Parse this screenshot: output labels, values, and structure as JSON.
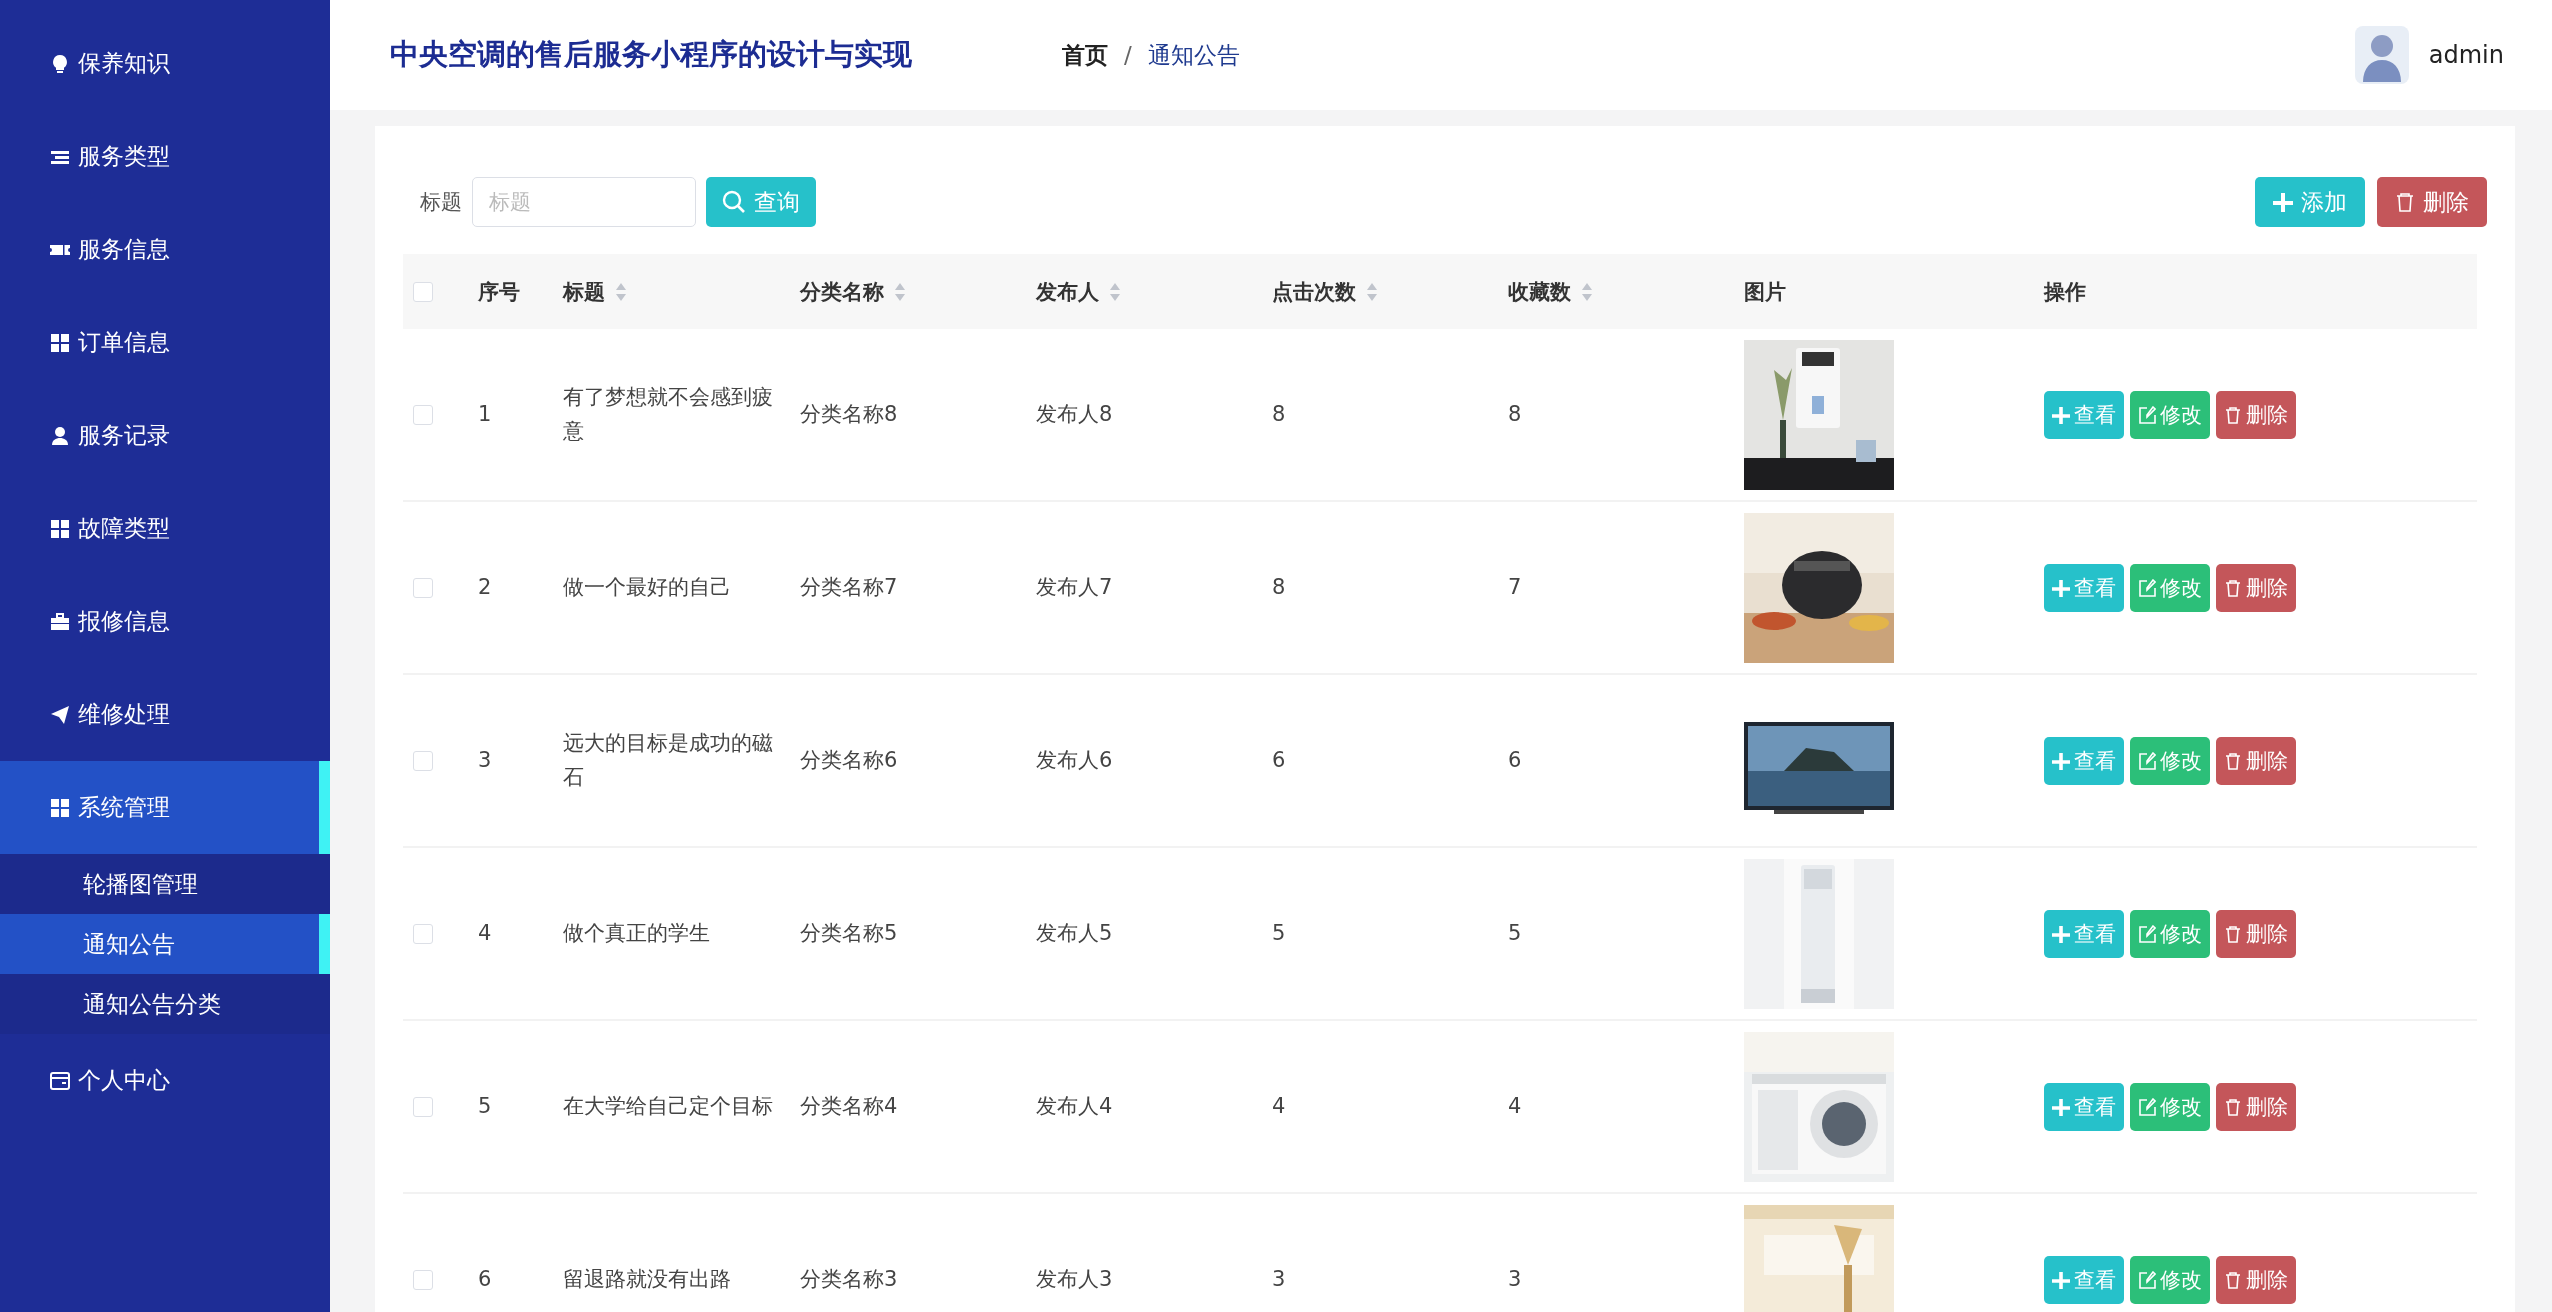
{
  "sidebar": {
    "items": [
      {
        "label": "保养知识",
        "selected": false
      },
      {
        "label": "服务类型",
        "selected": false
      },
      {
        "label": "服务信息",
        "selected": false
      },
      {
        "label": "订单信息",
        "selected": false
      },
      {
        "label": "服务记录",
        "selected": false
      },
      {
        "label": "故障类型",
        "selected": false
      },
      {
        "label": "报修信息",
        "selected": false
      },
      {
        "label": "维修处理",
        "selected": false
      },
      {
        "label": "系统管理",
        "selected": true,
        "children": [
          {
            "label": "轮播图管理",
            "selected": false
          },
          {
            "label": "通知公告",
            "selected": true
          },
          {
            "label": "通知公告分类",
            "selected": false
          }
        ]
      },
      {
        "label": "个人中心",
        "selected": false
      }
    ]
  },
  "header": {
    "title": "中央空调的售后服务小程序的设计与实现",
    "breadcrumb": [
      {
        "label": "首页"
      },
      {
        "label": "通知公告"
      }
    ],
    "separator": "/",
    "user": {
      "name": "admin"
    }
  },
  "search": {
    "label": "标题",
    "placeholder": "标题",
    "button": "查询"
  },
  "toolbar": [
    {
      "label": "添加",
      "kind": "add"
    },
    {
      "label": "删除",
      "kind": "delete"
    }
  ],
  "table": {
    "header_checked": false,
    "columns": [
      {
        "label": "序号",
        "sortable": false
      },
      {
        "label": "标题",
        "sortable": true
      },
      {
        "label": "分类名称",
        "sortable": true
      },
      {
        "label": "发布人",
        "sortable": true
      },
      {
        "label": "点击次数",
        "sortable": true
      },
      {
        "label": "收藏数",
        "sortable": true
      },
      {
        "label": "图片",
        "sortable": false
      },
      {
        "label": "操作",
        "sortable": false
      }
    ],
    "rows": [
      {
        "checked": false,
        "cells": [
          "1",
          "有了梦想就不会感到疲意",
          "分类名称8",
          "发布人8",
          "8",
          "8"
        ],
        "actions": [
          {
            "label": "查看",
            "kind": "view"
          },
          {
            "label": "修改",
            "kind": "edit"
          },
          {
            "label": "删除",
            "kind": "delete"
          }
        ]
      },
      {
        "checked": false,
        "cells": [
          "2",
          "做一个最好的自己",
          "分类名称7",
          "发布人7",
          "8",
          "7"
        ],
        "actions": [
          {
            "label": "查看",
            "kind": "view"
          },
          {
            "label": "修改",
            "kind": "edit"
          },
          {
            "label": "删除",
            "kind": "delete"
          }
        ]
      },
      {
        "checked": false,
        "cells": [
          "3",
          "远大的目标是成功的磁石",
          "分类名称6",
          "发布人6",
          "6",
          "6"
        ],
        "actions": [
          {
            "label": "查看",
            "kind": "view"
          },
          {
            "label": "修改",
            "kind": "edit"
          },
          {
            "label": "删除",
            "kind": "delete"
          }
        ]
      },
      {
        "checked": false,
        "cells": [
          "4",
          "做个真正的学生",
          "分类名称5",
          "发布人5",
          "5",
          "5"
        ],
        "actions": [
          {
            "label": "查看",
            "kind": "view"
          },
          {
            "label": "修改",
            "kind": "edit"
          },
          {
            "label": "删除",
            "kind": "delete"
          }
        ]
      },
      {
        "checked": false,
        "cells": [
          "5",
          "在大学给自己定个目标",
          "分类名称4",
          "发布人4",
          "4",
          "4"
        ],
        "actions": [
          {
            "label": "查看",
            "kind": "view"
          },
          {
            "label": "修改",
            "kind": "edit"
          },
          {
            "label": "删除",
            "kind": "delete"
          }
        ]
      },
      {
        "checked": false,
        "cells": [
          "6",
          "留退路就没有出路",
          "分类名称3",
          "发布人3",
          "3",
          "3"
        ],
        "actions": [
          {
            "label": "查看",
            "kind": "view"
          },
          {
            "label": "修改",
            "kind": "edit"
          },
          {
            "label": "删除",
            "kind": "delete"
          }
        ]
      }
    ]
  }
}
